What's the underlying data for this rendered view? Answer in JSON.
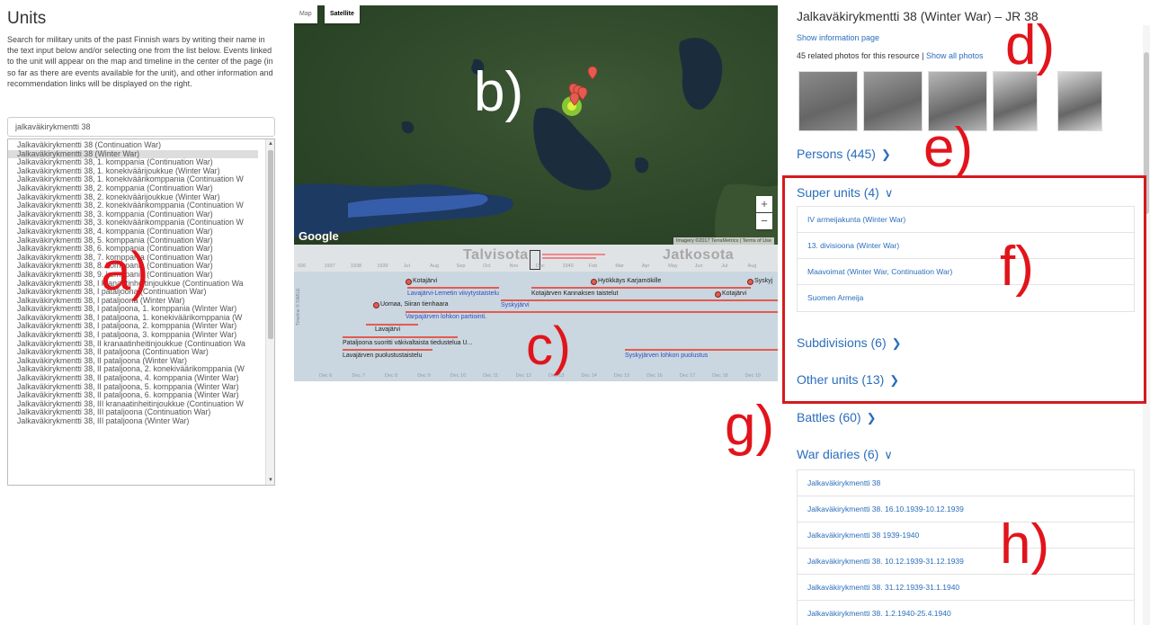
{
  "left": {
    "title": "Units",
    "description": "Search for military units of the past Finnish wars by writing their name in the text input below and/or selecting one from the list below. Events linked to the unit will appear on the map and timeline in the center of the page (in so far as there are events available for the unit), and other information and recommendation links will be displayed on the right.",
    "search_value": "jalkaväkirykmentti 38",
    "units": [
      "Jalkaväkirykmentti 38 (Continuation War)",
      "Jalkaväkirykmentti 38 (Winter War)",
      "Jalkaväkirykmentti 38, 1. komppania (Continuation War)",
      "Jalkaväkirykmentti 38, 1. konekiväärijoukkue (Winter War)",
      "Jalkaväkirykmentti 38, 1. konekiväärikomppania (Continuation W",
      "Jalkaväkirykmentti 38, 2. komppania (Continuation War)",
      "Jalkaväkirykmentti 38, 2. konekiväärijoukkue (Winter War)",
      "Jalkaväkirykmentti 38, 2. konekiväärikomppania (Continuation W",
      "Jalkaväkirykmentti 38, 3. komppania (Continuation War)",
      "Jalkaväkirykmentti 38, 3. konekiväärikomppania (Continuation W",
      "Jalkaväkirykmentti 38, 4. komppania (Continuation War)",
      "Jalkaväkirykmentti 38, 5. komppania (Continuation War)",
      "Jalkaväkirykmentti 38, 6. komppania (Continuation War)",
      "Jalkaväkirykmentti 38, 7. komppania (Continuation War)",
      "Jalkaväkirykmentti 38, 8. komppania (Continuation War)",
      "Jalkaväkirykmentti 38, 9. komppania (Continuation War)",
      "Jalkaväkirykmentti 38, I kranaatinheitinjoukkue (Continuation Wa",
      "Jalkaväkirykmentti 38, I pataljoona (Continuation War)",
      "Jalkaväkirykmentti 38, I pataljoona (Winter War)",
      "Jalkaväkirykmentti 38, I pataljoona, 1. komppania (Winter War)",
      "Jalkaväkirykmentti 38, I pataljoona, 1. konekiväärikomppania (W",
      "Jalkaväkirykmentti 38, I pataljoona, 2. komppania (Winter War)",
      "Jalkaväkirykmentti 38, I pataljoona, 3. komppania (Winter War)",
      "Jalkaväkirykmentti 38, II kranaatinheitinjoukkue (Continuation Wa",
      "Jalkaväkirykmentti 38, II pataljoona (Continuation War)",
      "Jalkaväkirykmentti 38, II pataljoona (Winter War)",
      "Jalkaväkirykmentti 38, II pataljoona, 2. konekiväärikomppania (W",
      "Jalkaväkirykmentti 38, II pataljoona, 4. komppania (Winter War)",
      "Jalkaväkirykmentti 38, II pataljoona, 5. komppania (Winter War)",
      "Jalkaväkirykmentti 38, II pataljoona, 6. komppania (Winter War)",
      "Jalkaväkirykmentti 38, III kranaatinheitinjoukkue (Continuation W",
      "Jalkaväkirykmentti 38, III pataljoona (Continuation War)",
      "Jalkaväkirykmentti 38, III pataljoona (Winter War)"
    ],
    "selected_index": 1
  },
  "map": {
    "type_map": "Map",
    "type_satellite": "Satellite",
    "zoom_in": "+",
    "zoom_out": "−",
    "logo": "Google",
    "attribution": "Imagery ©2017 TerraMetrics | Terms of Use"
  },
  "timeline": {
    "war1": "Talvisota",
    "war2": "Jatkosota",
    "overview_ticks": [
      "936",
      "1937",
      "1938",
      "1939",
      "Jul",
      "Aug",
      "Sep",
      "Oct",
      "Nov",
      "Dec",
      "1940",
      "Feb",
      "Mar",
      "Apr",
      "May",
      "Jun",
      "Jul",
      "Aug"
    ],
    "bottom_ticks": [
      "Dec 6",
      "Dec 7",
      "Dec 8",
      "Dec 9",
      "Dec 10",
      "Dec 11",
      "Dec 12",
      "Dec 13",
      "Dec 14",
      "Dec 15",
      "Dec 16",
      "Dec 17",
      "Dec 18",
      "Dec 19"
    ],
    "side_label": "Timeline © SIMILE",
    "events": {
      "kotajarvi1": "Kotajärvi",
      "hyokkays": "Hyökkäys Karjamökille",
      "kotajarvi2": "Kotajärvi",
      "syskyjarvi_top": "Syskyj",
      "lavajarvi_lemetin": "Lavajärvi-Lemetin viivytystaistelu",
      "kotajarven_kannaksen": "Kotajärven Kannaksen taistelut",
      "syskyjarvi": "Syskyjärvi",
      "uomaa": "Uomaa, Siiran tienhaara",
      "varpajarven": "Varpajärven lohkon partiointi.",
      "lavajarvi": "Lavajärvi",
      "pataljoona": "Pataljoona suoritti väkivaltaista tiedustelua U...",
      "lavajarven_puolustus": "Lavajärven puolustustaistelu",
      "syskyjarven_lohkon": "Syskyjärven lohkon puolustus"
    }
  },
  "right": {
    "title": "Jalkaväkirykmentti 38 (Winter War) – JR 38",
    "show_info": "Show information page",
    "photos_text": "45 related photos for this resource |",
    "show_all_photos": "Show all photos",
    "photo_count": 5,
    "persons": "Persons (445)",
    "super_units": "Super units (4)",
    "super_unit_rows": [
      "IV armeijakunta (Winter War)",
      "13. divisioona (Winter War)",
      "Maavoimat (Winter War, Continuation War)",
      "Suomen Armeija"
    ],
    "subdivisions": "Subdivisions (6)",
    "other_units": "Other units (13)",
    "battles": "Battles (60)",
    "war_diaries": "War diaries (6)",
    "war_diary_rows": [
      "Jalkaväkirykmentti 38",
      "Jalkaväkirykmentti 38. 16.10.1939-10.12.1939",
      "Jalkaväkirykmentti 38 1939-1940",
      "Jalkaväkirykmentti 38. 10.12.1939-31.12.1939",
      "Jalkaväkirykmentti 38. 31.12.1939-31.1.1940",
      "Jalkaväkirykmentti 38. 1.2.1940-25.4.1940"
    ]
  },
  "annotations": {
    "a": "a)",
    "b": "b)",
    "c": "c)",
    "d": "d)",
    "e": "e)",
    "f": "f)",
    "g": "g)",
    "h": "h)"
  },
  "colors": {
    "link": "#2a6ebb",
    "annotation": "#e2141b",
    "timeline_bar": "#e45b4f",
    "timeline_event_blue": "#2f4fbf"
  }
}
